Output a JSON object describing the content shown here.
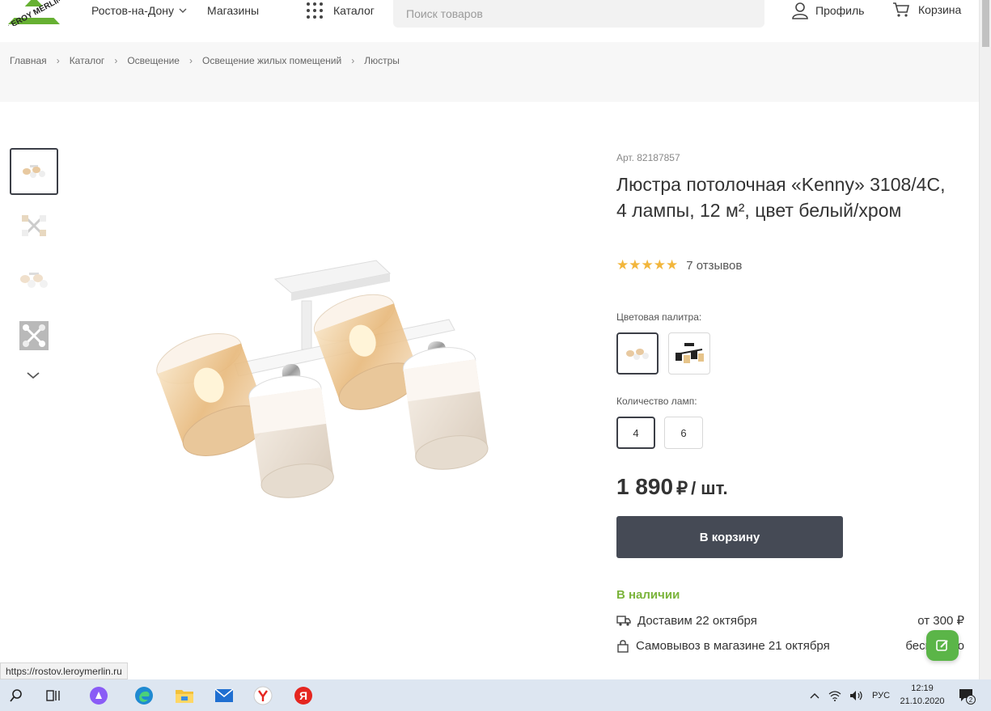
{
  "header": {
    "logo_text": "LEROY MERLIN",
    "city": "Ростов-на-Дону",
    "stores": "Магазины",
    "catalog": "Каталог",
    "search_placeholder": "Поиск товаров",
    "profile": "Профиль",
    "cart": "Корзина"
  },
  "breadcrumb": [
    "Главная",
    "Каталог",
    "Освещение",
    "Освещение жилых помещений",
    "Люстры"
  ],
  "product": {
    "article": "Арт. 82187857",
    "title": "Люстра потолочная «Kenny» 3108/4C, 4 лампы, 12 м², цвет белый/хром",
    "stars": "★★★★★",
    "reviews": "7 отзывов",
    "color_label": "Цветовая палитра:",
    "lamps_label": "Количество ламп:",
    "lamp_options": [
      "4",
      "6"
    ],
    "price": "1 890",
    "currency": "₽",
    "unit": "/ шт.",
    "add_to_cart": "В корзину",
    "availability": "В наличии",
    "delivery_text": "Доставим 22 октября",
    "delivery_price": "от 300 ₽",
    "pickup_text": "Самовывоз в магазине 21 октября",
    "pickup_price": "бесплатно"
  },
  "status_url": "https://rostov.leroymerlin.ru",
  "taskbar": {
    "lang": "РУС",
    "time": "12:19",
    "date": "21.10.2020",
    "notifications": "2"
  },
  "colors": {
    "accent_green": "#7bb43b",
    "button_dark": "#454a55",
    "star": "#f2b63c",
    "logo_green": "#66b032"
  }
}
